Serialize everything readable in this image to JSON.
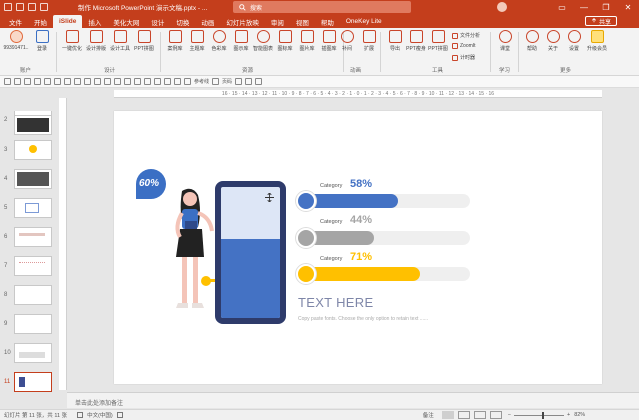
{
  "titlebar": {
    "title": "制作 Microsoft PowerPoint 演示文稿.pptx - ...",
    "search_placeholder": "搜索",
    "minimize": "—",
    "restore": "❐",
    "close": "✕"
  },
  "tabs": [
    "文件",
    "开始",
    "iSlide",
    "插入",
    "美化大网",
    "设计",
    "切换",
    "动画",
    "幻灯片放映",
    "审阅",
    "视图",
    "帮助",
    "OneKey Lite"
  ],
  "active_tab": "iSlide",
  "share_label": "共享",
  "ribbon": {
    "account": {
      "label": "99391471..",
      "login": "登录",
      "group": "账户"
    },
    "design": {
      "items": [
        "一键优化",
        "设计排版",
        "设计工具",
        "PPT拼图"
      ],
      "group": "设计"
    },
    "resources": {
      "items": [
        "案例库",
        "主题库",
        "色彩库",
        "图示库",
        "智能图表",
        "图标库",
        "图片库",
        "插图库"
      ],
      "group": "资源"
    },
    "animation": {
      "items": [
        "补间",
        "扩展"
      ],
      "group": "动画"
    },
    "tools": {
      "items": [
        "导出",
        "PPT瘦身",
        "PPT拼图"
      ],
      "small": [
        "文件分析",
        "ZoomIt",
        "计时器"
      ],
      "group": "工具"
    },
    "learning": {
      "items": [
        "课堂"
      ],
      "group": "学习"
    },
    "more": {
      "items": [
        "帮助",
        "关于",
        "设置",
        "升级会员"
      ],
      "group": "更多"
    }
  },
  "toolbar2": {
    "ref_line": "参考线",
    "slide_no": "页码"
  },
  "ruler_text": "16 · 15 · 14 · 13 · 12 · 11 · 10 · 9 · 8 · 7 · 6 · 5 · 4 · 3 · 2 · 1 · 0 · 1 · 2 · 3 · 4 · 5 · 6 · 7 · 8 · 9 · 10 · 11 · 12 · 13 · 14 · 15 · 16",
  "thumbnails": [
    "2",
    "3",
    "4",
    "5",
    "6",
    "7",
    "8",
    "9",
    "10",
    "11"
  ],
  "slide": {
    "bubble_pct": "60%",
    "bars": [
      {
        "category": "Category",
        "pct": "58%",
        "value": 58,
        "color": "#4472c4"
      },
      {
        "category": "Category",
        "pct": "44%",
        "value": 44,
        "color": "#a5a5a5"
      },
      {
        "category": "Category",
        "pct": "71%",
        "value": 71,
        "color": "#ffc000"
      }
    ],
    "heading": "TEXT HERE",
    "body": "Copy paste fonts. Choose the only option to retain text ......"
  },
  "notes_placeholder": "单击此处添加备注",
  "status": {
    "slide_info": "幻灯片 第 11 张，共 11 张",
    "language": "中文(中国)",
    "notes": "备注",
    "zoom": "82%"
  }
}
